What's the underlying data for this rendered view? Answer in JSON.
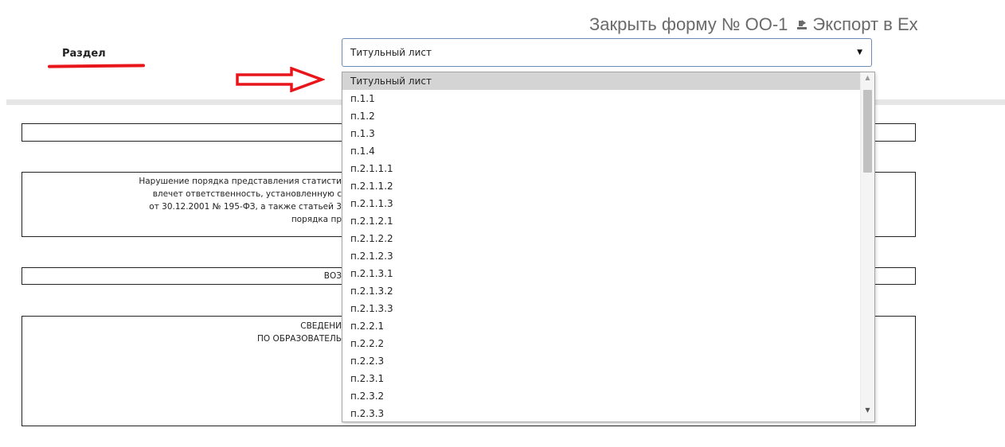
{
  "header": {
    "close_form": "Закрыть форму № ОО-1",
    "export": "Экспорт в Ex"
  },
  "section": {
    "label": "Раздел",
    "selected": "Титульный лист",
    "options": [
      "Титульный лист",
      "п.1.1",
      "п.1.2",
      "п.1.3",
      "п.1.4",
      "п.2.1.1.1",
      "п.2.1.1.2",
      "п.2.1.1.3",
      "п.2.1.2.1",
      "п.2.1.2.2",
      "п.2.1.2.3",
      "п.2.1.3.1",
      "п.2.1.3.2",
      "п.2.1.3.3",
      "п.2.2.1",
      "п.2.2.2",
      "п.2.2.3",
      "п.2.3.1",
      "п.2.3.2",
      "п.2.3.3"
    ]
  },
  "document": {
    "notice_lines": [
      "Нарушение порядка представления статисти",
      "влечет ответственность, установленную с",
      "от 30.12.2001 № 195-ФЗ, а также статьей 3",
      "порядка пр"
    ],
    "box3_text": "ВОЗ",
    "box4_lines": [
      "СВЕДЕНИ",
      "ПО ОБРАЗОВАТЕЛЬ"
    ]
  },
  "colors": {
    "annotation_red": "#e8161b",
    "select_border": "#6c8ab6",
    "selected_option_bg": "#d4d4d4"
  }
}
